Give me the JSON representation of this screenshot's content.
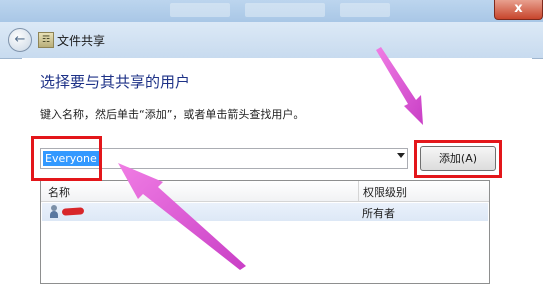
{
  "window": {
    "title": "文件共享",
    "close_label": "x",
    "back_icon": "back-arrow-icon"
  },
  "dialog": {
    "heading": "选择要与其共享的用户",
    "instruction": "键入名称，然后单击“添加”，或者单击箭头查找用户。",
    "input_value": "Everyone",
    "add_button": "添加(A)",
    "columns": {
      "name": "名称",
      "permission": "权限级别"
    },
    "rows": [
      {
        "name": "",
        "permission": "所有者",
        "icon": "user-icon"
      }
    ]
  },
  "annotations": {
    "highlight_color": "#e3161a",
    "arrow_color": "#e05ad8"
  }
}
